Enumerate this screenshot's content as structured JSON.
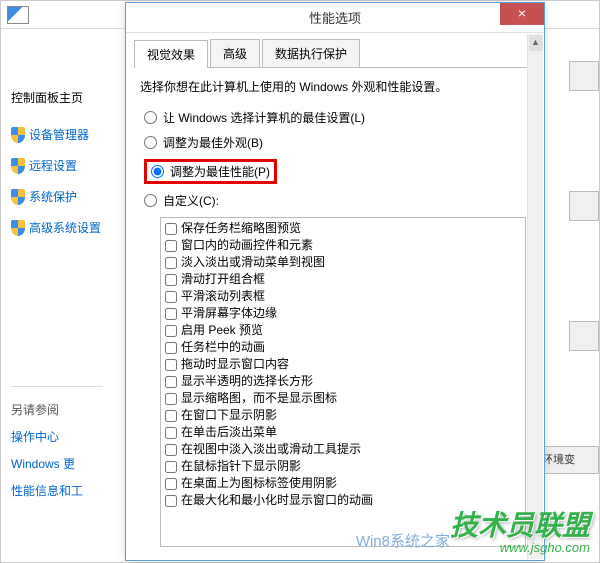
{
  "bgwin": {
    "title_icon": "control-panel"
  },
  "sidebar": {
    "title": "控制面板主页",
    "links": [
      {
        "label": "设备管理器"
      },
      {
        "label": "远程设置"
      },
      {
        "label": "系统保护"
      },
      {
        "label": "高级系统设置"
      }
    ],
    "see_also": "另请参阅",
    "plain": [
      {
        "label": "操作中心"
      },
      {
        "label": "Windows 更"
      },
      {
        "label": "性能信息和工"
      }
    ]
  },
  "right": {
    "env_btn": "环境变"
  },
  "dialog": {
    "title": "性能选项",
    "close": "×",
    "tabs": [
      {
        "label": "视觉效果",
        "active": true
      },
      {
        "label": "高级",
        "active": false
      },
      {
        "label": "数据执行保护",
        "active": false
      }
    ],
    "instruction": "选择你想在此计算机上使用的 Windows 外观和性能设置。",
    "radios": [
      {
        "label": "让 Windows 选择计算机的最佳设置(L)",
        "checked": false,
        "highlight": false
      },
      {
        "label": "调整为最佳外观(B)",
        "checked": false,
        "highlight": false
      },
      {
        "label": "调整为最佳性能(P)",
        "checked": true,
        "highlight": true
      },
      {
        "label": "自定义(C):",
        "checked": false,
        "highlight": false
      }
    ],
    "checks": [
      "保存任务栏缩略图预览",
      "窗口内的动画控件和元素",
      "淡入淡出或滑动菜单到视图",
      "滑动打开组合框",
      "平滑滚动列表框",
      "平滑屏幕字体边缘",
      "启用 Peek 预览",
      "任务栏中的动画",
      "拖动时显示窗口内容",
      "显示半透明的选择长方形",
      "显示缩略图，而不是显示图标",
      "在窗口下显示阴影",
      "在单击后淡出菜单",
      "在视图中淡入淡出或滑动工具提示",
      "在鼠标指针下显示阴影",
      "在桌面上为图标标签使用阴影",
      "在最大化和最小化时显示窗口的动画"
    ]
  },
  "watermark": {
    "brand": "技术员联盟",
    "url": "www.jsgho.com",
    "sub": "Win8系统之家"
  }
}
